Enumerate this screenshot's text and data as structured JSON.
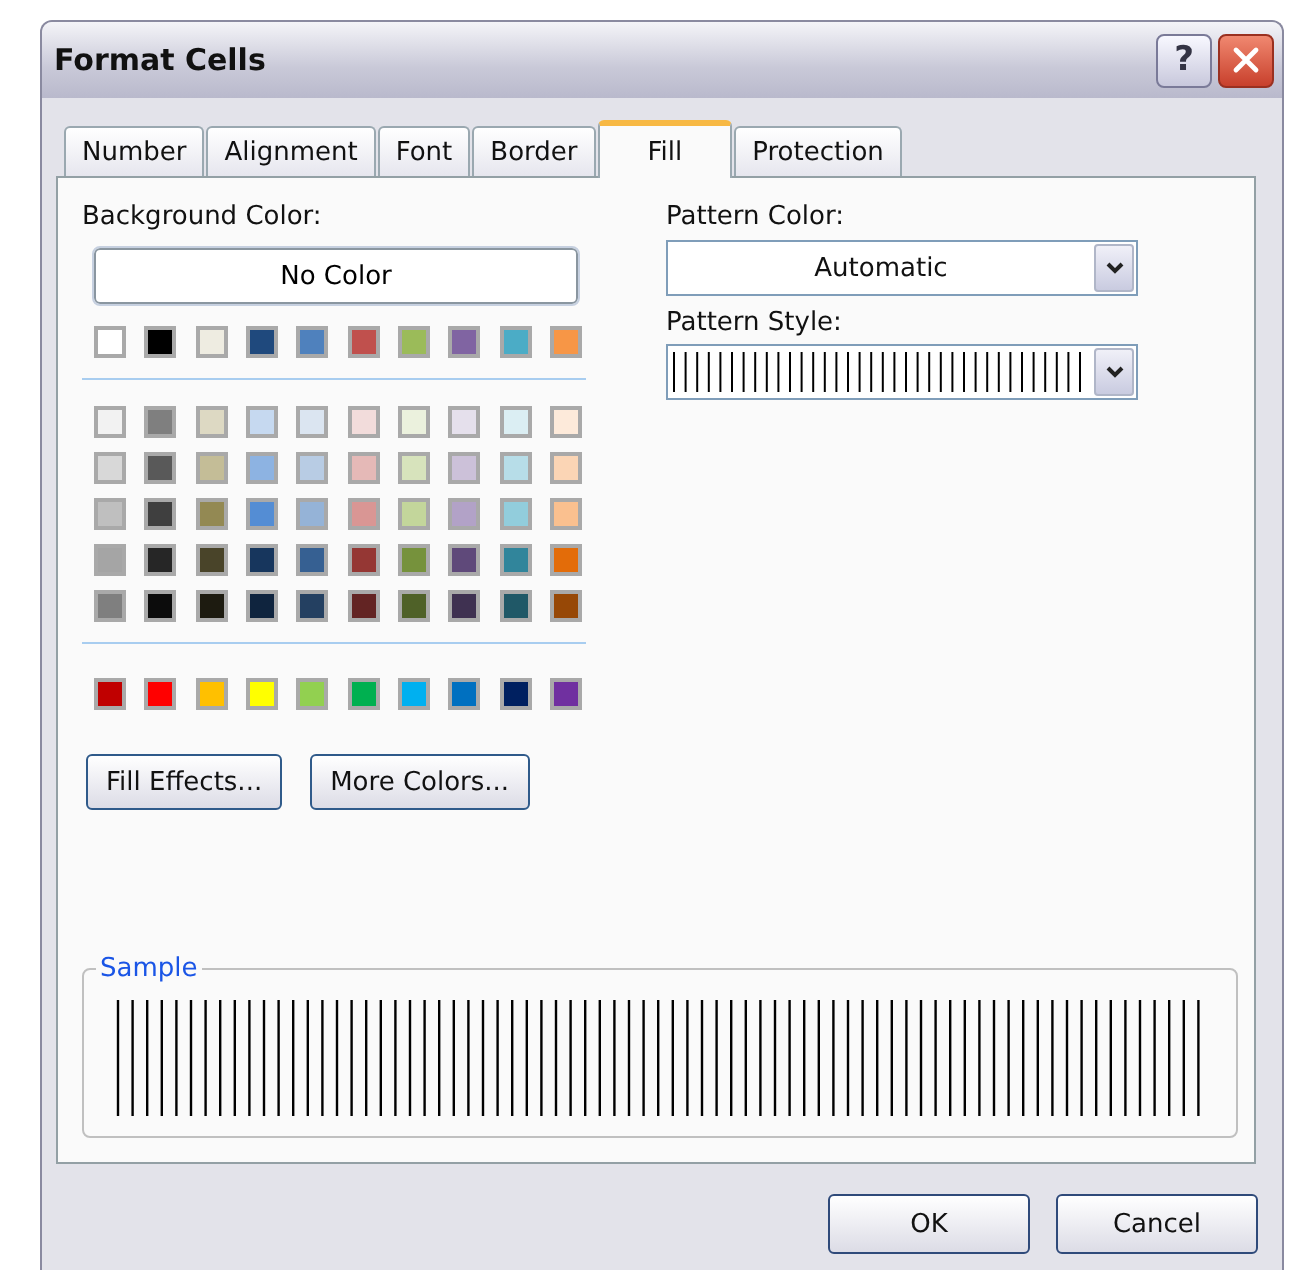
{
  "window": {
    "title": "Format Cells",
    "help_button": "?"
  },
  "tabs": [
    {
      "label": "Number",
      "selected": false
    },
    {
      "label": "Alignment",
      "selected": false
    },
    {
      "label": "Font",
      "selected": false
    },
    {
      "label": "Border",
      "selected": false
    },
    {
      "label": "Fill",
      "selected": true
    },
    {
      "label": "Protection",
      "selected": false
    }
  ],
  "background_color": {
    "label": "Background Color:",
    "no_color_button": "No Color",
    "theme_colors": [
      {
        "color": "#ffffff"
      },
      {
        "color": "#000000"
      },
      {
        "color": "#eeece1"
      },
      {
        "color": "#1f497d"
      },
      {
        "color": "#4f81bd"
      },
      {
        "color": "#c0504d"
      },
      {
        "color": "#9bbb59"
      },
      {
        "color": "#8064a2"
      },
      {
        "color": "#4bacc6"
      },
      {
        "color": "#f79646"
      }
    ],
    "tint_rows": [
      {
        "swatches": [
          {
            "color": "#f2f2f2"
          },
          {
            "color": "#7f7f7f"
          },
          {
            "color": "#ddd9c3"
          },
          {
            "color": "#c6d9f0"
          },
          {
            "color": "#dbe5f1"
          },
          {
            "color": "#f2dcdb"
          },
          {
            "color": "#ebf1dd"
          },
          {
            "color": "#e5e0ec"
          },
          {
            "color": "#dbeef3"
          },
          {
            "color": "#fdeada"
          }
        ]
      },
      {
        "swatches": [
          {
            "color": "#d8d8d8"
          },
          {
            "color": "#595959"
          },
          {
            "color": "#c4bd97"
          },
          {
            "color": "#8db3e2"
          },
          {
            "color": "#b8cce4"
          },
          {
            "color": "#e5b9b7"
          },
          {
            "color": "#d7e3bc"
          },
          {
            "color": "#ccc1d9"
          },
          {
            "color": "#b7dde8"
          },
          {
            "color": "#fbd5b5"
          }
        ]
      },
      {
        "swatches": [
          {
            "color": "#bfbfbf"
          },
          {
            "color": "#3f3f3f"
          },
          {
            "color": "#938953"
          },
          {
            "color": "#548dd4"
          },
          {
            "color": "#95b3d7"
          },
          {
            "color": "#d99694"
          },
          {
            "color": "#c3d69b"
          },
          {
            "color": "#b2a2c7"
          },
          {
            "color": "#92cddc"
          },
          {
            "color": "#fac08f"
          }
        ]
      },
      {
        "swatches": [
          {
            "color": "#a5a5a5"
          },
          {
            "color": "#262626"
          },
          {
            "color": "#494429"
          },
          {
            "color": "#17365d"
          },
          {
            "color": "#366092"
          },
          {
            "color": "#953734"
          },
          {
            "color": "#76923c"
          },
          {
            "color": "#5f497a"
          },
          {
            "color": "#31859b"
          },
          {
            "color": "#e36c09"
          }
        ]
      },
      {
        "swatches": [
          {
            "color": "#7f7f7f"
          },
          {
            "color": "#0c0c0c"
          },
          {
            "color": "#1d1b10"
          },
          {
            "color": "#0f243e"
          },
          {
            "color": "#244061"
          },
          {
            "color": "#632423"
          },
          {
            "color": "#4f6128"
          },
          {
            "color": "#3f3151"
          },
          {
            "color": "#205867"
          },
          {
            "color": "#974806"
          }
        ]
      }
    ],
    "standard_colors": [
      {
        "color": "#c00000"
      },
      {
        "color": "#ff0000"
      },
      {
        "color": "#ffc000"
      },
      {
        "color": "#ffff00"
      },
      {
        "color": "#92d050"
      },
      {
        "color": "#00b050"
      },
      {
        "color": "#00b0f0"
      },
      {
        "color": "#0070c0"
      },
      {
        "color": "#002060"
      },
      {
        "color": "#7030a0"
      }
    ]
  },
  "fill_effects_button": "Fill Effects...",
  "more_colors_button": "More Colors...",
  "pattern_color": {
    "label": "Pattern Color:",
    "value": "Automatic"
  },
  "pattern_style": {
    "label": "Pattern Style:",
    "kind": "vertical-stripe"
  },
  "sample": {
    "label": "Sample",
    "kind": "vertical-stripe"
  },
  "buttons": [
    "OK",
    "Cancel"
  ]
}
